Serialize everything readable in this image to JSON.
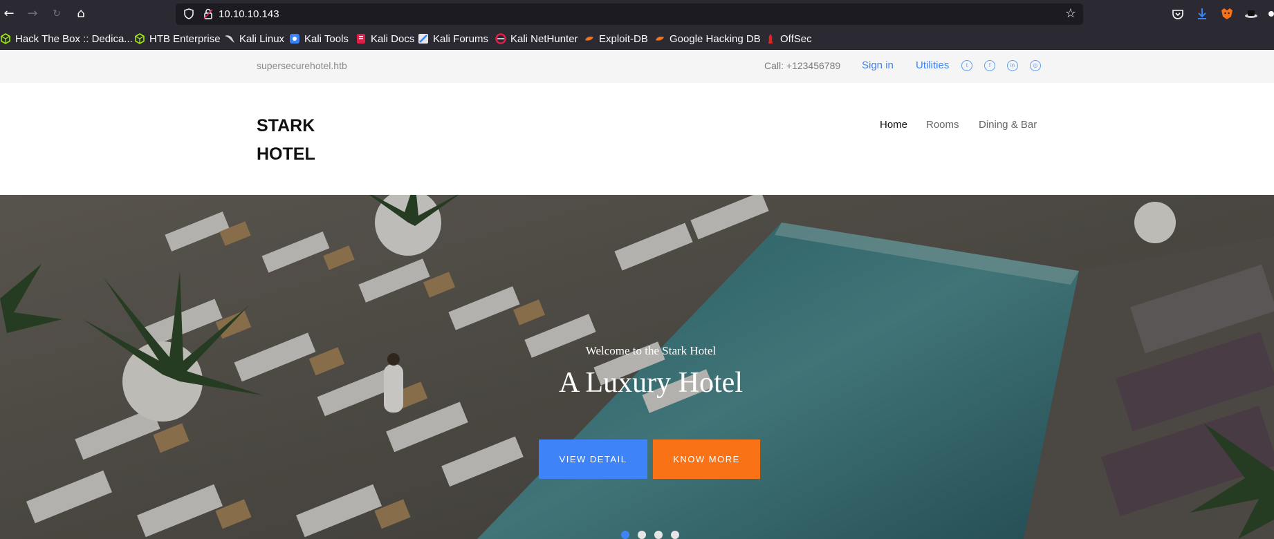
{
  "browser": {
    "url": "10.10.10.143",
    "bookmarks": [
      {
        "label": "Hack The Box :: Dedica...",
        "color": "#9fef00"
      },
      {
        "label": "HTB Enterprise",
        "color": "#9fef00"
      },
      {
        "label": "Kali Linux",
        "color": "#3b82f6"
      },
      {
        "label": "Kali Tools",
        "color": "#3b82f6"
      },
      {
        "label": "Kali Docs",
        "color": "#e11d48"
      },
      {
        "label": "Kali Forums",
        "color": "#3b82f6"
      },
      {
        "label": "Kali NetHunter",
        "color": "#e11d48"
      },
      {
        "label": "Exploit-DB",
        "color": "#f97316"
      },
      {
        "label": "Google Hacking DB",
        "color": "#f97316"
      },
      {
        "label": "OffSec",
        "color": "#dc2626"
      }
    ]
  },
  "topbar": {
    "domain": "supersecurehotel.htb",
    "call": "Call: +123456789",
    "signin": "Sign in",
    "utilities": "Utilities",
    "social_icons": [
      "twitter-icon",
      "facebook-icon",
      "linkedin-icon",
      "instagram-icon"
    ]
  },
  "header": {
    "logo_line1": "STARK",
    "logo_line2": "HOTEL",
    "nav": [
      {
        "label": "Home",
        "active": true
      },
      {
        "label": "Rooms",
        "active": false
      },
      {
        "label": "Dining & Bar",
        "active": false
      }
    ]
  },
  "hero": {
    "welcome": "Welcome to the Stark Hotel",
    "headline": "A Luxury Hotel",
    "view_detail": "VIEW DETAIL",
    "know_more": "KNOW MORE",
    "slides_total": 4,
    "slide_active": 1
  },
  "colors": {
    "accent_blue": "#3f83f8",
    "accent_orange": "#f97316",
    "link_blue": "#3b82f6"
  }
}
